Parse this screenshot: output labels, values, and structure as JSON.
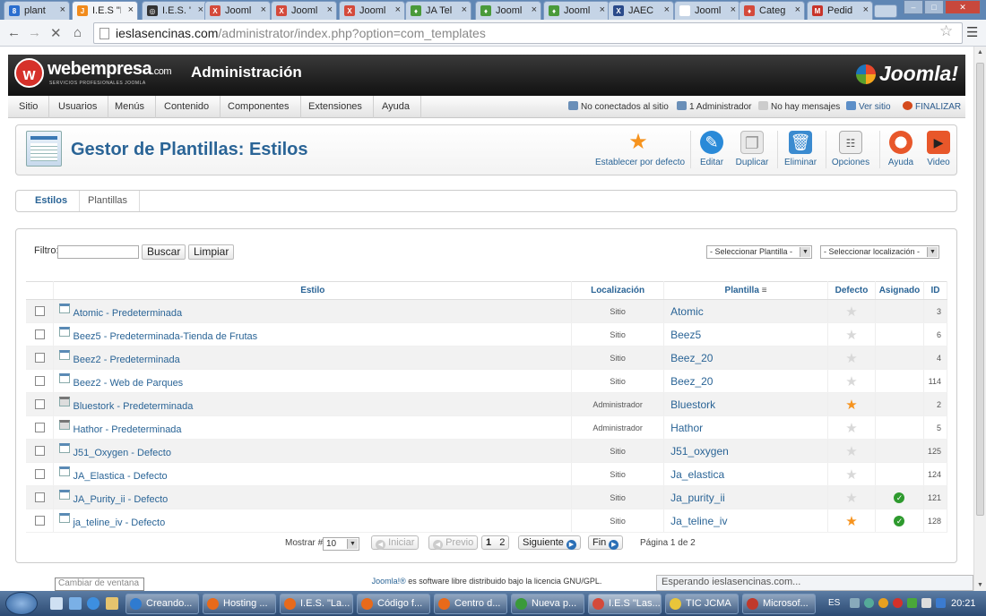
{
  "browser": {
    "tabs": [
      {
        "label": "plant",
        "fav": "8",
        "favcolor": "#2a6ecf"
      },
      {
        "label": "I.E.S \"L",
        "fav": "J",
        "favcolor": "#f18b1c"
      },
      {
        "label": "I.E.S. \"",
        "fav": "◎",
        "favcolor": "#333333"
      },
      {
        "label": "Jooml",
        "fav": "X",
        "favcolor": "#d44a3b"
      },
      {
        "label": "Jooml",
        "fav": "X",
        "favcolor": "#d44a3b"
      },
      {
        "label": "Jooml",
        "fav": "X",
        "favcolor": "#d44a3b"
      },
      {
        "label": "JA Tel",
        "fav": "♦",
        "favcolor": "#4a9a3a"
      },
      {
        "label": "Jooml",
        "fav": "♦",
        "favcolor": "#4a9a3a"
      },
      {
        "label": "Jooml",
        "fav": "♦",
        "favcolor": "#4a9a3a"
      },
      {
        "label": "JAEC I",
        "fav": "X",
        "favcolor": "#2a4a8a"
      },
      {
        "label": "Jooml",
        "fav": "",
        "favcolor": "#ffffff"
      },
      {
        "label": "Categ",
        "fav": "♦",
        "favcolor": "#d44a3b"
      },
      {
        "label": "Pedid",
        "fav": "M",
        "favcolor": "#c8342a"
      }
    ],
    "url_domain": "ieslasencinas.com",
    "url_path": "/administrator/index.php?option=com_templates",
    "status_text": "Esperando ieslasencinas.com..."
  },
  "header": {
    "brand": "webempresa",
    "brand_suffix": ".com",
    "brand_sub": "SERVICIOS PROFESIONALES JOOMLA",
    "title": "Administración",
    "joomla": "Joomla!"
  },
  "menu": {
    "items": [
      "Sitio",
      "Usuarios",
      "Menús",
      "Contenido",
      "Componentes",
      "Extensiones",
      "Ayuda"
    ],
    "status": {
      "not_connected": "No conectados al sitio",
      "admins": "1 Administrador",
      "messages": "No hay mensajes",
      "view_site": "Ver sitio",
      "logout": "FINALIZAR"
    }
  },
  "toolbar": {
    "title": "Gestor de Plantillas: Estilos",
    "buttons": {
      "default": "Establecer por defecto",
      "edit": "Editar",
      "duplicate": "Duplicar",
      "delete": "Eliminar",
      "options": "Opciones",
      "help": "Ayuda",
      "video": "Video"
    }
  },
  "subnav": {
    "styles": "Estilos",
    "templates": "Plantillas"
  },
  "filter": {
    "label": "Filtro:",
    "search": "Buscar",
    "clear": "Limpiar",
    "select_template": "- Seleccionar Plantilla -",
    "select_location": "- Seleccionar localización -"
  },
  "table": {
    "headers": {
      "style": "Estilo",
      "location": "Localización",
      "template": "Plantilla",
      "default": "Defecto",
      "assigned": "Asignado",
      "id": "ID"
    },
    "rows": [
      {
        "style": "Atomic - Predeterminada",
        "location": "Sitio",
        "template": "Atomic",
        "default": false,
        "assigned": false,
        "id": "3",
        "admin": false
      },
      {
        "style": "Beez5 - Predeterminada-Tienda de Frutas",
        "location": "Sitio",
        "template": "Beez5",
        "default": false,
        "assigned": false,
        "id": "6",
        "admin": false
      },
      {
        "style": "Beez2 - Predeterminada",
        "location": "Sitio",
        "template": "Beez_20",
        "default": false,
        "assigned": false,
        "id": "4",
        "admin": false
      },
      {
        "style": "Beez2 - Web de Parques",
        "location": "Sitio",
        "template": "Beez_20",
        "default": false,
        "assigned": false,
        "id": "114",
        "admin": false
      },
      {
        "style": "Bluestork - Predeterminada",
        "location": "Administrador",
        "template": "Bluestork",
        "default": true,
        "assigned": false,
        "id": "2",
        "admin": true
      },
      {
        "style": "Hathor - Predeterminada",
        "location": "Administrador",
        "template": "Hathor",
        "default": false,
        "assigned": false,
        "id": "5",
        "admin": true
      },
      {
        "style": "J51_Oxygen - Defecto",
        "location": "Sitio",
        "template": "J51_oxygen",
        "default": false,
        "assigned": false,
        "id": "125",
        "admin": false
      },
      {
        "style": "JA_Elastica - Defecto",
        "location": "Sitio",
        "template": "Ja_elastica",
        "default": false,
        "assigned": false,
        "id": "124",
        "admin": false
      },
      {
        "style": "JA_Purity_ii - Defecto",
        "location": "Sitio",
        "template": "Ja_purity_ii",
        "default": false,
        "assigned": true,
        "id": "121",
        "admin": false
      },
      {
        "style": "ja_teline_iv - Defecto",
        "location": "Sitio",
        "template": "Ja_teline_iv",
        "default": true,
        "assigned": true,
        "id": "128",
        "admin": false
      }
    ]
  },
  "pagination": {
    "show_label": "Mostrar #",
    "show_value": "10",
    "start": "Iniciar",
    "prev": "Previo",
    "page1": "1",
    "page2": "2",
    "next": "Siguiente",
    "end": "Fin",
    "page_info": "Página 1 de 2"
  },
  "footer": {
    "link": "Joomla!®",
    "text": " es software libre distribuido bajo la licencia GNU/GPL."
  },
  "tooltip": "Cambiar de ventana",
  "taskbar": {
    "tasks": [
      {
        "label": "Creando...",
        "color": "#2f7bd0"
      },
      {
        "label": "Hosting ...",
        "color": "#e86a1a"
      },
      {
        "label": "I.E.S. \"La...",
        "color": "#e86a1a"
      },
      {
        "label": "Código f...",
        "color": "#e86a1a"
      },
      {
        "label": "Centro d...",
        "color": "#e86a1a"
      },
      {
        "label": "Nueva p...",
        "color": "#3a9a3a"
      },
      {
        "label": "I.E.S \"Las...",
        "color": "#d44a3b"
      },
      {
        "label": "TIC JCMA",
        "color": "#e8c53a"
      },
      {
        "label": "Microsof...",
        "color": "#c0392b"
      }
    ],
    "lang": "ES",
    "clock": "20:21"
  }
}
